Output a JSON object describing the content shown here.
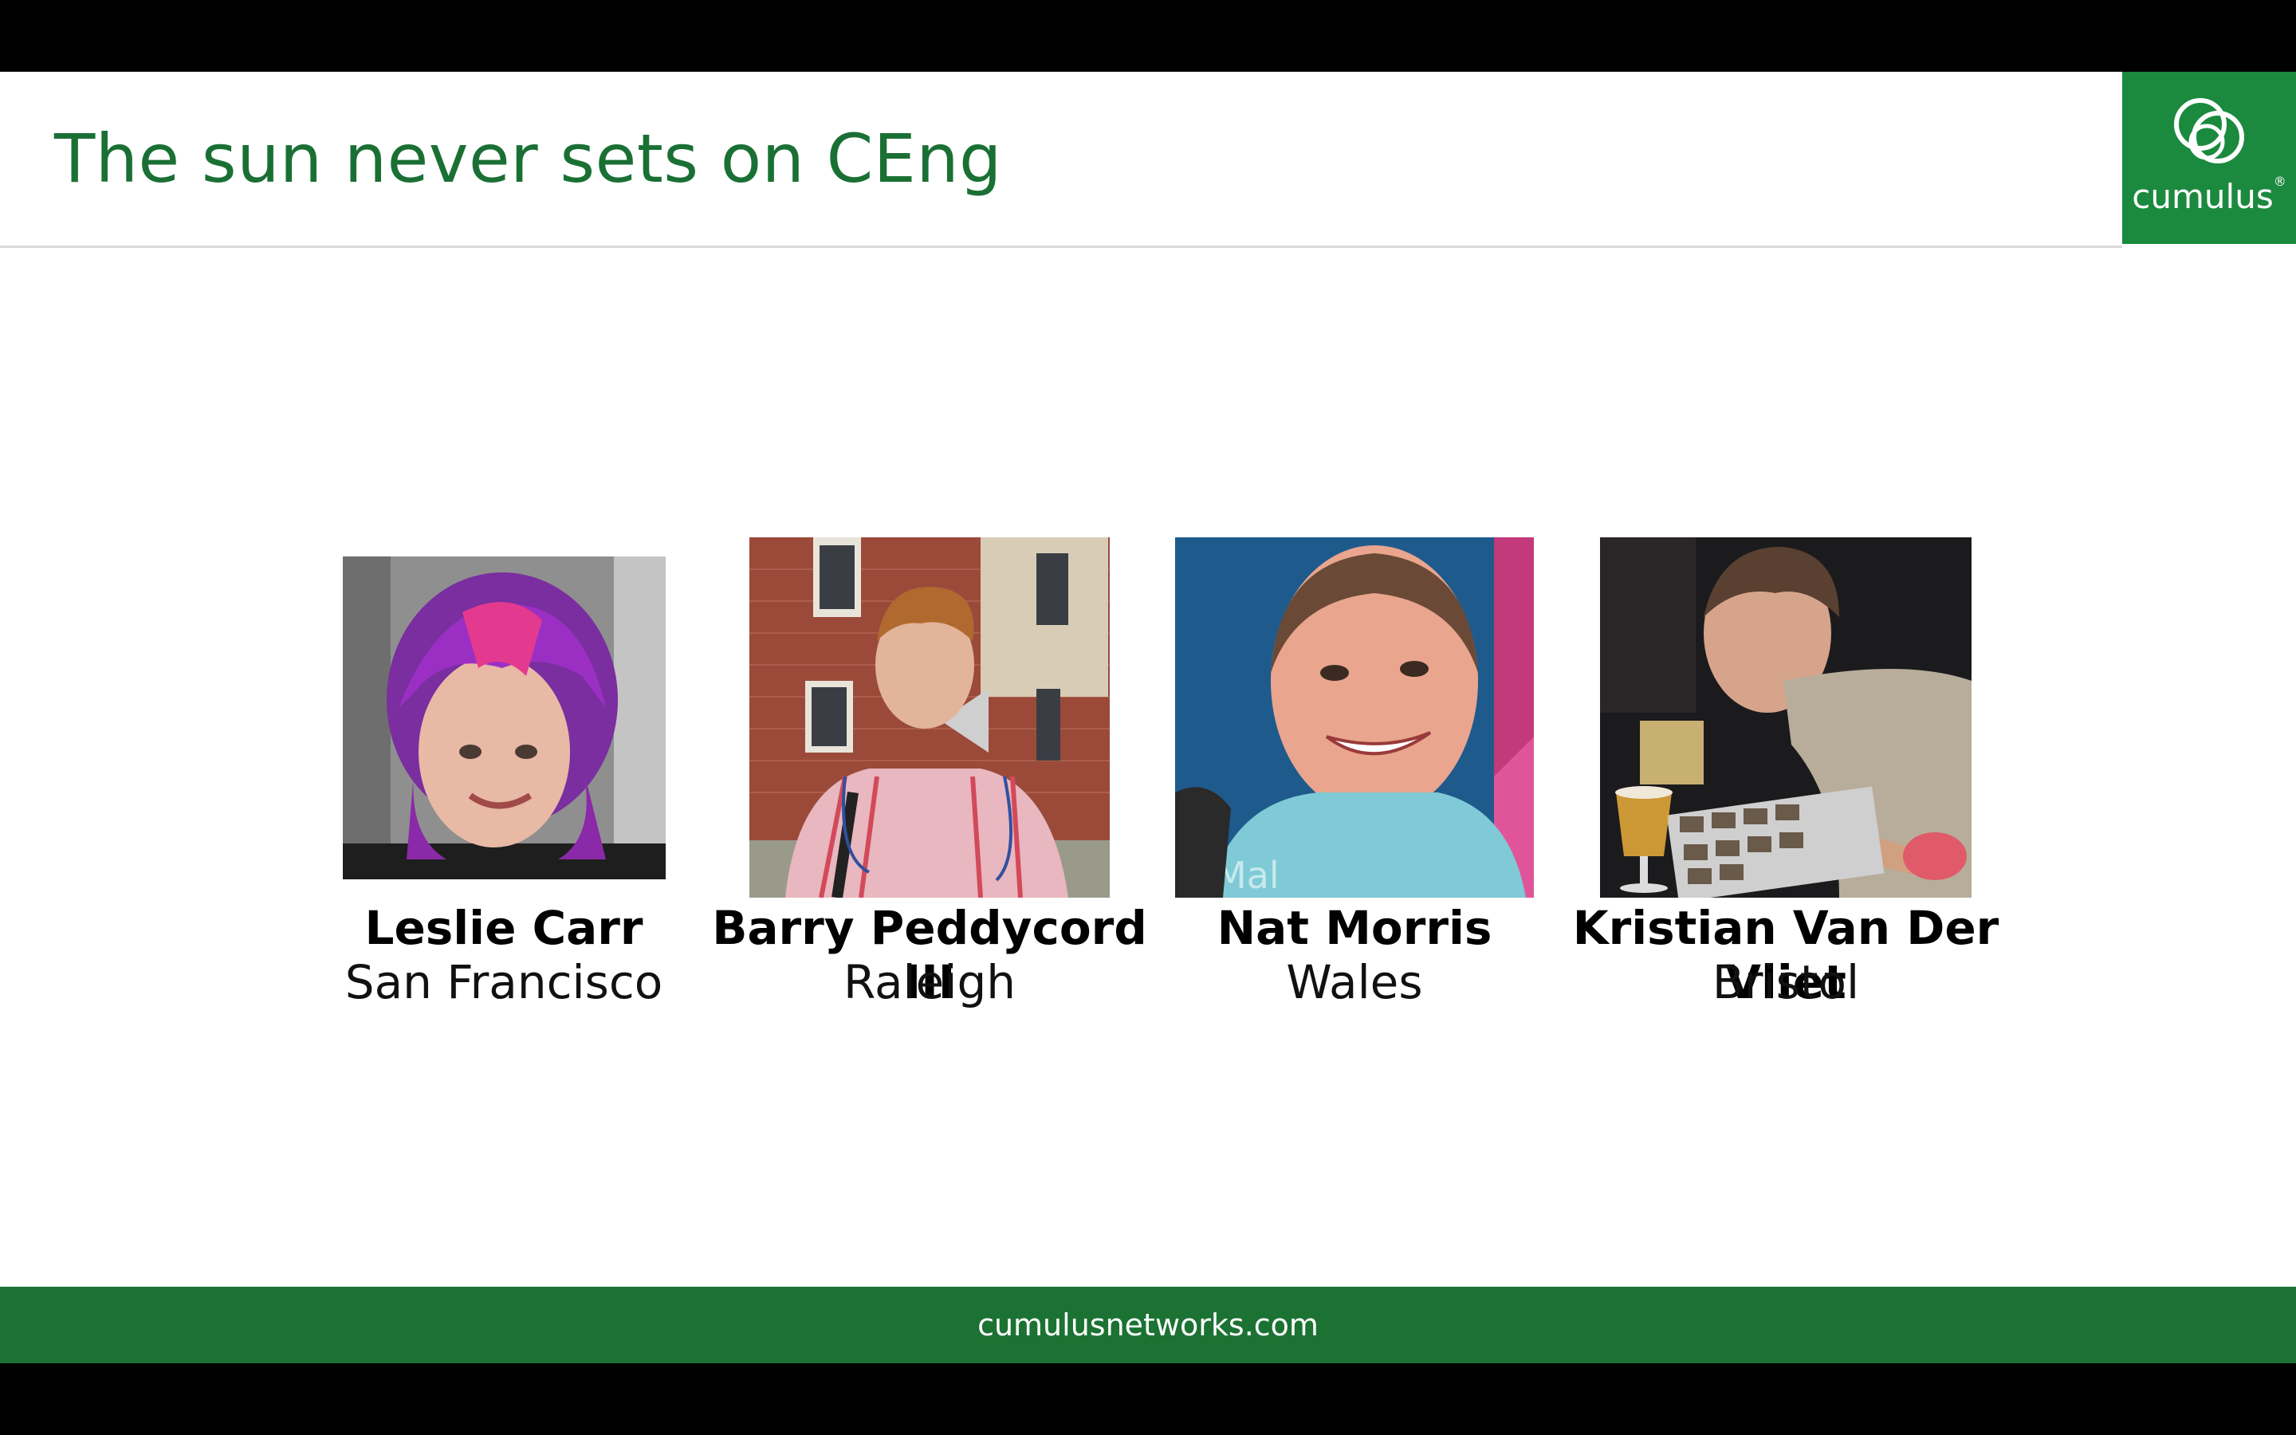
{
  "slide": {
    "title": "The sun never sets on CEng",
    "logo_text": "cumulus",
    "logo_mark": "®",
    "footer": "cumulusnetworks.com"
  },
  "people": [
    {
      "name": "Leslie Carr",
      "location": "San Francisco"
    },
    {
      "name": "Barry Peddycord III",
      "location": "Raleigh"
    },
    {
      "name": "Nat Morris",
      "location": "Wales"
    },
    {
      "name": "Kristian Van Der Vliet",
      "location": "Bristol"
    }
  ],
  "colors": {
    "brand_green": "#1b8a3e",
    "title_green": "#1a7034",
    "footer_green": "#1b7232"
  }
}
